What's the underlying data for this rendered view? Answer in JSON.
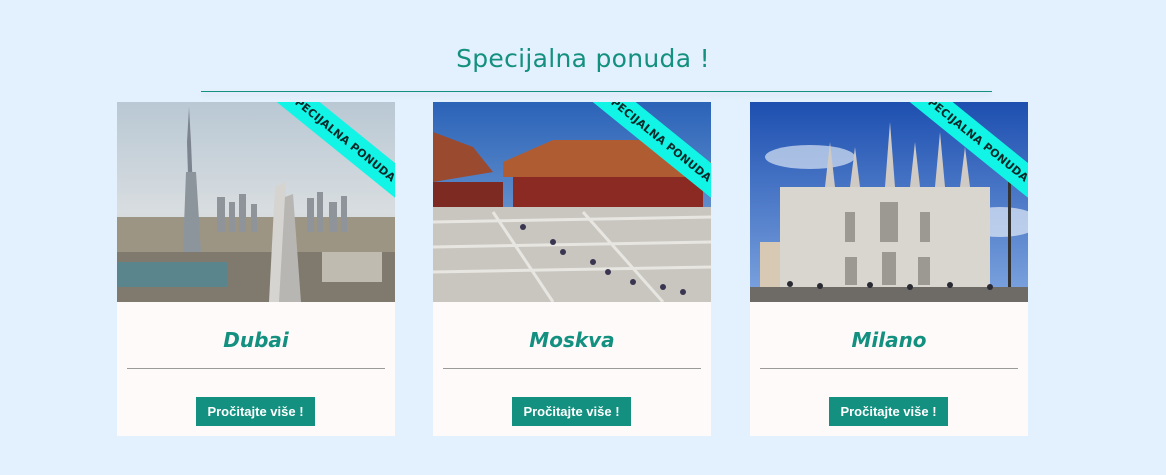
{
  "section": {
    "title": "Specijalna ponuda !"
  },
  "colors": {
    "accent": "#13907f",
    "ribbon": "#12f4e6",
    "background": "#e3f0fd",
    "card": "#fefafa"
  },
  "cards": [
    {
      "ribbon": "SPECIJALNA PONUDA",
      "city": "Dubai",
      "button": "Pročitajte više !"
    },
    {
      "ribbon": "SPECIJALNA PONUDA",
      "city": "Moskva",
      "button": "Pročitajte više !"
    },
    {
      "ribbon": "SPECIJALNA PONUDA",
      "city": "Milano",
      "button": "Pročitajte više !"
    }
  ]
}
